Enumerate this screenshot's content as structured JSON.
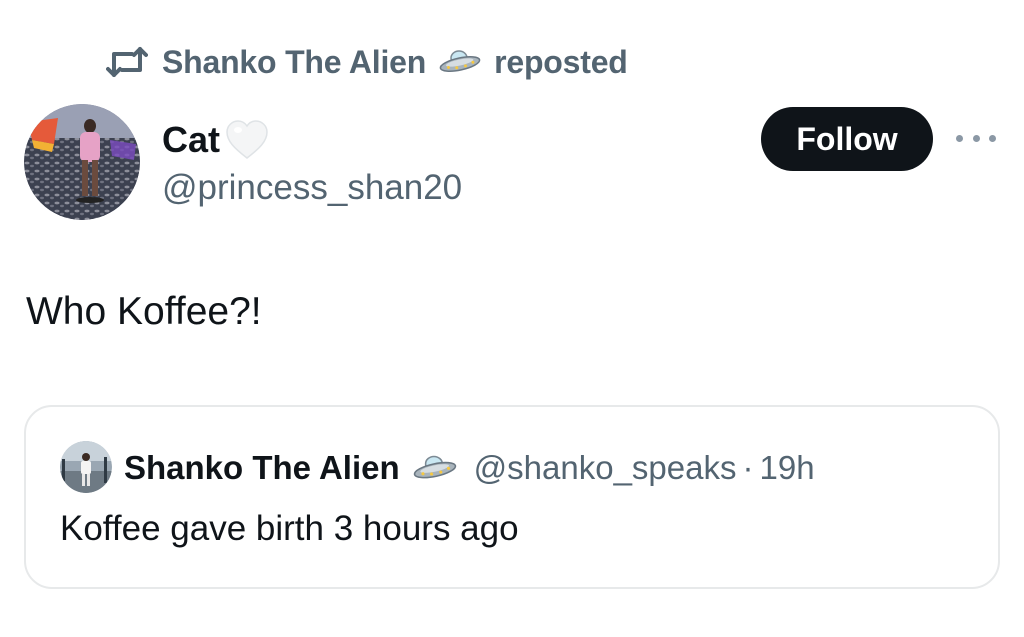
{
  "repost": {
    "icon": "repost-icon",
    "name": "Shanko The Alien",
    "badge_icon": "ufo-icon",
    "suffix": "reposted"
  },
  "post": {
    "author": {
      "display_name": "Cat",
      "emoji_icon": "white-heart-icon",
      "handle": "@princess_shan20",
      "avatar_icon": "profile-avatar"
    },
    "follow_label": "Follow",
    "more_icon": "more-options-icon",
    "text": "Who Koffee?!"
  },
  "quote": {
    "author": {
      "display_name": "Shanko The Alien",
      "badge_icon": "ufo-icon",
      "handle": "@shanko_speaks",
      "avatar_icon": "profile-avatar"
    },
    "separator": "·",
    "time": "19h",
    "text": "Koffee gave birth 3 hours ago"
  },
  "colors": {
    "primary_text": "#0f1419",
    "secondary_text": "#536471",
    "border": "#e7e9ea",
    "follow_bg": "#0f1419",
    "follow_text": "#ffffff"
  }
}
